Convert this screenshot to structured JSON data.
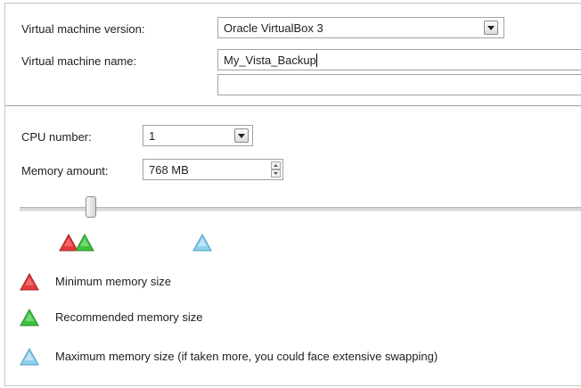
{
  "form": {
    "vm_version_label": "Virtual machine version:",
    "vm_version_value": "Oracle VirtualBox 3",
    "vm_name_label": "Virtual machine name:",
    "vm_name_value": "My_Vista_Backup",
    "cpu_label": "CPU number:",
    "cpu_value": "1",
    "memory_label": "Memory amount:",
    "memory_value": "768 MB"
  },
  "memory_slider": {
    "value_mb": 768
  },
  "legend": {
    "minimum": "Minimum memory size",
    "recommended": "Recommended memory size",
    "maximum": "Maximum memory size (if taken more, you could face extensive swapping)"
  },
  "colors": {
    "minimum": "#e53b3b",
    "recommended": "#3fc23f",
    "maximum": "#8fd0ef"
  },
  "icons": {
    "dropdown": "chevron-down-icon",
    "spinner": "spin-updown-icon",
    "minimum": "red-triangle-icon",
    "recommended": "green-triangle-icon",
    "maximum": "blue-triangle-icon"
  }
}
